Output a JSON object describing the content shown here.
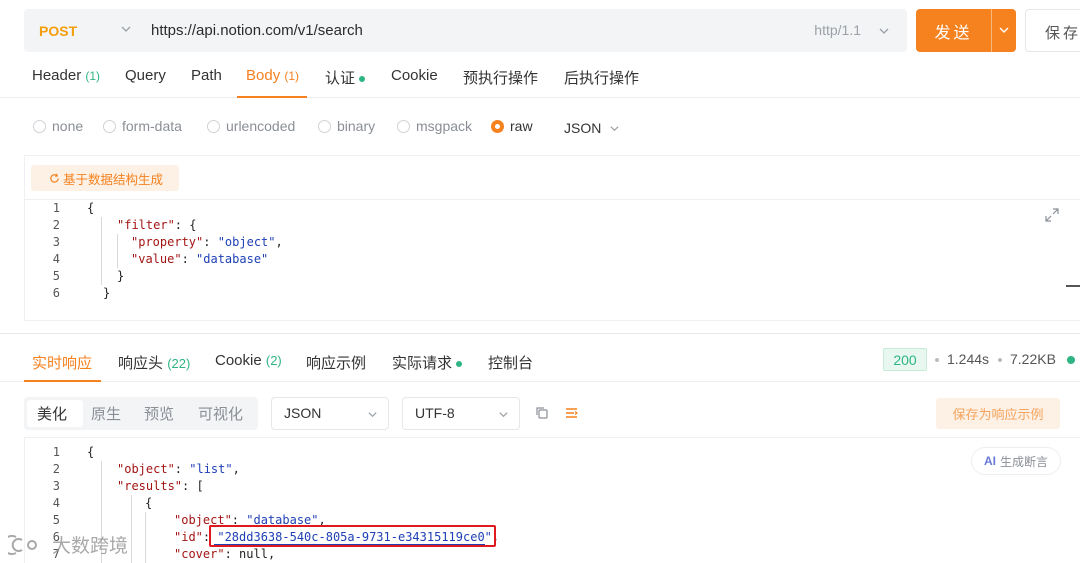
{
  "request": {
    "method": "POST",
    "url": "https://api.notion.com/v1/search",
    "protocol": "http/1.1",
    "send_label": "发送",
    "save_label": "保存"
  },
  "request_tabs": [
    {
      "label": "Header",
      "count": "(1)"
    },
    {
      "label": "Query",
      "count": ""
    },
    {
      "label": "Path",
      "count": ""
    },
    {
      "label": "Body",
      "count": "(1)"
    },
    {
      "label": "认证",
      "count": ""
    },
    {
      "label": "Cookie",
      "count": ""
    },
    {
      "label": "预执行操作",
      "count": ""
    },
    {
      "label": "后执行操作",
      "count": ""
    }
  ],
  "body_types": [
    "none",
    "form-data",
    "urlencoded",
    "binary",
    "msgpack",
    "raw"
  ],
  "body_format": "JSON",
  "generate_button": "基于数据结构生成",
  "request_body_lines": [
    "1",
    "2",
    "3",
    "4",
    "5",
    "6"
  ],
  "request_body_code": {
    "l1": "{",
    "l2_key": "\"filter\"",
    "l2_rest": ": {",
    "l3_key": "\"property\"",
    "l3_sep": ": ",
    "l3_val": "\"object\"",
    "l3_end": ",",
    "l4_key": "\"value\"",
    "l4_sep": ": ",
    "l4_val": "\"database\"",
    "l5": "}",
    "l6": "}"
  },
  "response_tabs": [
    {
      "label": "实时响应",
      "count": ""
    },
    {
      "label": "响应头",
      "count": "(22)"
    },
    {
      "label": "Cookie",
      "count": "(2)"
    },
    {
      "label": "响应示例",
      "count": ""
    },
    {
      "label": "实际请求",
      "count": ""
    },
    {
      "label": "控制台",
      "count": ""
    }
  ],
  "response_meta": {
    "status": "200",
    "time": "1.244s",
    "size": "7.22KB"
  },
  "view_modes": [
    "美化",
    "原生",
    "预览",
    "可视化"
  ],
  "response_format": "JSON",
  "response_encoding": "UTF-8",
  "save_example_label": "保存为响应示例",
  "ai_button": {
    "badge": "AI",
    "label": "生成断言"
  },
  "response_lines": [
    "1",
    "2",
    "3",
    "4",
    "5",
    "6",
    "7"
  ],
  "response_code": {
    "l1": "{",
    "l2_key": "\"object\"",
    "l2_sep": ": ",
    "l2_val": "\"list\"",
    "l2_end": ",",
    "l3_key": "\"results\"",
    "l3_rest": ": [",
    "l4": "{",
    "l5_key": "\"object\"",
    "l5_sep": ": ",
    "l5_val": "\"database\"",
    "l5_end": ",",
    "l6_key": "\"id\"",
    "l6_sep": ": ",
    "l6_val": "\"28dd3638-540c-805a-9731-e34315119ce0\"",
    "l6_end": ",",
    "l7_key": "\"cover\"",
    "l7_sep": ": ",
    "l7_val": "null",
    "l7_end": ","
  },
  "watermark": "大数跨境",
  "colors": {
    "accent": "#f5811f",
    "success": "#2fb583",
    "method": "#f59e0b",
    "json_key": "#a31515",
    "json_string": "#1e3fb5",
    "highlight_box": "#e0191f"
  }
}
